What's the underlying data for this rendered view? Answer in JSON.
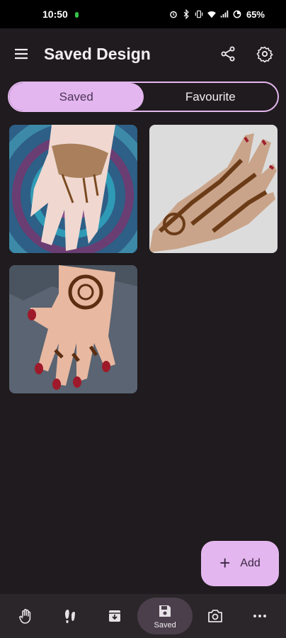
{
  "status": {
    "time": "10:50",
    "battery": "65%"
  },
  "app_bar": {
    "title": "Saved Design",
    "menu_icon": "hamburger-menu-icon",
    "share_icon": "share-icon",
    "settings_icon": "gear-icon"
  },
  "tabs": [
    {
      "label": "Saved",
      "active": true
    },
    {
      "label": "Favourite",
      "active": false
    }
  ],
  "gallery": {
    "items": [
      {
        "name": "mehndi-design-1"
      },
      {
        "name": "mehndi-design-2"
      },
      {
        "name": "mehndi-design-3"
      }
    ]
  },
  "fab": {
    "label": "Add",
    "icon": "plus-icon"
  },
  "bottom_nav": {
    "items": [
      {
        "icon": "hand-icon",
        "label": "",
        "active": false
      },
      {
        "icon": "feet-icon",
        "label": "",
        "active": false
      },
      {
        "icon": "archive-icon",
        "label": "",
        "active": false
      },
      {
        "icon": "save-icon",
        "label": "Saved",
        "active": true
      },
      {
        "icon": "camera-icon",
        "label": "",
        "active": false
      },
      {
        "icon": "more-icon",
        "label": "",
        "active": false
      }
    ]
  },
  "colors": {
    "background": "#1f1b1e",
    "accent": "#e4b6ef",
    "nav_bar": "#2b262a"
  }
}
